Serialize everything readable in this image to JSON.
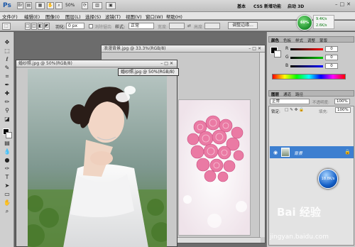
{
  "app": {
    "logo": "Ps",
    "zoom": "50%",
    "workspaces": [
      "基本",
      "CSS 新增功能",
      "启动 3D"
    ],
    "cslive": ""
  },
  "menu": [
    "文件(F)",
    "编辑(E)",
    "图像(I)",
    "图层(L)",
    "选择(S)",
    "滤镜(T)",
    "视图(V)",
    "窗口(W)",
    "帮助(H)"
  ],
  "options": {
    "feather_label": "羽化:",
    "feather_value": "0 px",
    "antialias_label": "消除锯齿",
    "style_label": "样式:",
    "style_value": "正常",
    "width_label": "宽度:",
    "height_label": "高度:",
    "refine_edge": "调整边缘..."
  },
  "speed_widget": {
    "percent": "60%",
    "up": "9.4K/s",
    "down": "2.6K/s"
  },
  "documents": {
    "background_doc_title": "浪漫背景.jpg @ 33.3%(RGB/8)",
    "photo_doc_title": "婚纱照.jpg @ 50%(RGB/8)",
    "drag_tooltip": "婚纱照.jpg @ 50%(RGB/8)"
  },
  "color_panel": {
    "tabs": [
      "颜色",
      "色板",
      "样式",
      "调整",
      "蒙版"
    ],
    "channels": [
      {
        "label": "R",
        "value": "0"
      },
      {
        "label": "G",
        "value": "0"
      },
      {
        "label": "B",
        "value": "0"
      }
    ]
  },
  "layers_panel": {
    "tabs": [
      "图层",
      "通道",
      "路径"
    ],
    "blend_mode": "正常",
    "opacity_label": "不透明度:",
    "opacity_value": "100%",
    "lock_label": "锁定:",
    "fill_label": "填充:",
    "fill_value": "100%",
    "layer_name": "背景"
  },
  "speed_ball": "18.8K/s",
  "watermark": {
    "main": "Bai 经验",
    "sub": "jingyan.baidu.com"
  }
}
